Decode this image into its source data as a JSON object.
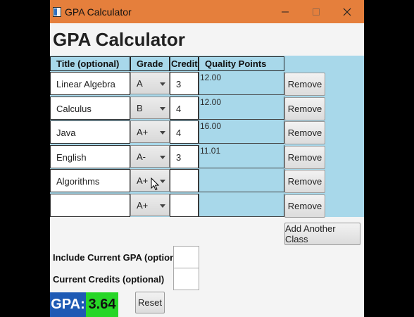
{
  "window": {
    "title": "GPA Calculator",
    "controls": {
      "minimize": "—",
      "maximize": "☐",
      "close": "✕"
    }
  },
  "app_title": "GPA Calculator",
  "table": {
    "headers": {
      "title": "Title (optional)",
      "grade": "Grade",
      "credits": "Credits",
      "quality": "Quality Points"
    },
    "rows": [
      {
        "title": "Linear Algebra",
        "grade": "A",
        "credits": "3",
        "quality": "12.00",
        "remove": "Remove"
      },
      {
        "title": "Calculus",
        "grade": "B",
        "credits": "4",
        "quality": "12.00",
        "remove": "Remove"
      },
      {
        "title": "Java",
        "grade": "A+",
        "credits": "4",
        "quality": "16.00",
        "remove": "Remove"
      },
      {
        "title": "English",
        "grade": "A-",
        "credits": "3",
        "quality": "11.01",
        "remove": "Remove"
      },
      {
        "title": "Algorithms",
        "grade": "A+",
        "credits": "",
        "quality": "",
        "remove": "Remove"
      },
      {
        "title": "",
        "grade": "A+",
        "credits": "",
        "quality": "",
        "remove": "Remove"
      }
    ]
  },
  "add_button": "Add Another Class",
  "include_gpa_label": "Include Current GPA (optional)",
  "include_gpa_value": "",
  "current_credits_label": "Current Credits (optional)",
  "current_credits_value": "",
  "gpa": {
    "label": "GPA:",
    "value": "3.64"
  },
  "reset_button": "Reset",
  "colors": {
    "titlebar": "#e57f3c",
    "panel": "#a8d8ea",
    "gpa_label_bg": "#1e5ab4",
    "gpa_value_bg": "#27d627"
  }
}
